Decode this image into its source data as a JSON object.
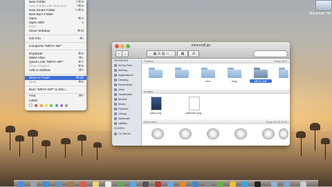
{
  "context_menu": {
    "items": [
      {
        "label": "New Folder",
        "shortcut": "⇧⌘N"
      },
      {
        "label": "New Folder with Selection",
        "shortcut": "^⌘N",
        "disabled": true
      },
      {
        "label": "New Smart Folder",
        "shortcut": "⌥⌘N"
      },
      {
        "label": "New Burn Folder",
        "shortcut": ""
      },
      {
        "label": "Open",
        "shortcut": "⌘O"
      },
      {
        "label": "Open With",
        "shortcut": "▸"
      },
      {
        "label": "Print",
        "shortcut": "",
        "disabled": true
      },
      {
        "label": "Close Window",
        "shortcut": "⌘W"
      },
      {
        "label": "Get Info",
        "shortcut": "⌘I"
      },
      {
        "label": "Compress “META-INF”",
        "shortcut": ""
      },
      {
        "label": "Duplicate",
        "shortcut": "⌘D"
      },
      {
        "label": "Make Alias",
        "shortcut": "⌘L"
      },
      {
        "label": "Quick Look “META-INF”",
        "shortcut": "⌘Y"
      },
      {
        "label": "Show Original",
        "shortcut": "⌘R",
        "disabled": true
      },
      {
        "label": "Add to Sidebar",
        "shortcut": "⌘T"
      },
      {
        "label": "Move to Trash",
        "shortcut": "⌘⌫",
        "highlighted": true
      },
      {
        "label": "Eject",
        "shortcut": "⌘E",
        "disabled": true
      },
      {
        "label": "Burn “META-INF” to Disc…",
        "shortcut": ""
      },
      {
        "label": "Find",
        "shortcut": "⌘F"
      },
      {
        "label": "Label:",
        "shortcut": ""
      }
    ],
    "label_colors": [
      "#e2483b",
      "#f19b37",
      "#f5d23c",
      "#6ac048",
      "#4e8fe0",
      "#a568c9",
      "#9a9a9a"
    ]
  },
  "finder": {
    "title": "minecraft.jar",
    "back_icon": "chevron-left-icon",
    "forward_icon": "chevron-right-icon",
    "sidebar": {
      "devices_label": "FAVORITES",
      "items": [
        {
          "label": "All My Files",
          "icon": "all-files-icon"
        },
        {
          "label": "AirDrop",
          "icon": "airdrop-icon"
        },
        {
          "label": "Applications",
          "icon": "applications-icon"
        },
        {
          "label": "Desktop",
          "icon": "desktop-icon"
        },
        {
          "label": "Documents",
          "icon": "documents-icon"
        },
        {
          "label": "other",
          "icon": "folder-icon"
        },
        {
          "label": "Downloads",
          "icon": "downloads-icon"
        },
        {
          "label": "Movies",
          "icon": "movies-icon"
        },
        {
          "label": "Music",
          "icon": "music-icon"
        },
        {
          "label": "Pictures",
          "icon": "pictures-icon"
        },
        {
          "label": "Library",
          "icon": "library-icon"
        },
        {
          "label": "minecraft",
          "icon": "folder-icon"
        },
        {
          "label": "Utilities",
          "icon": "utilities-icon"
        }
      ],
      "shared_label": "SHARED",
      "shared_items": [
        {
          "label": "Cu Server",
          "icon": "server-icon"
        }
      ]
    },
    "sections": {
      "folders": {
        "label": "Folders",
        "date": "Today 08:3"
      },
      "images": {
        "label": "Images"
      },
      "other": {
        "label": "Document",
        "date": "Done 04:11,2012"
      }
    },
    "folders": [
      {
        "name": "",
        "selected": false
      },
      {
        "name": "",
        "selected": false
      },
      {
        "name": "lamr",
        "selected": false
      },
      {
        "name": "lang",
        "selected": false
      },
      {
        "name": "META-INF",
        "selected": true
      },
      {
        "name": "",
        "selected": false
      }
    ],
    "images": [
      {
        "name": "pack.png"
      },
      {
        "name": "particles.png"
      }
    ]
  },
  "desktop": {
    "icon_label": "Macintosh HD"
  },
  "dock": {
    "icons": [
      "finder-icon",
      "launchpad-icon",
      "safari-icon",
      "mail-icon",
      "contacts-icon",
      "calendar-icon",
      "notes-icon",
      "reminders-icon",
      "maps-icon",
      "messages-icon",
      "facetime-icon",
      "photo-booth-icon",
      "itunes-icon",
      "ibooks-icon",
      "app-store-icon",
      "preferences-icon",
      "terminal-icon",
      "minecraft-icon",
      "chrome-icon",
      "skype-icon",
      "folder-icon",
      "downloads-icon",
      "trash-icon"
    ]
  }
}
